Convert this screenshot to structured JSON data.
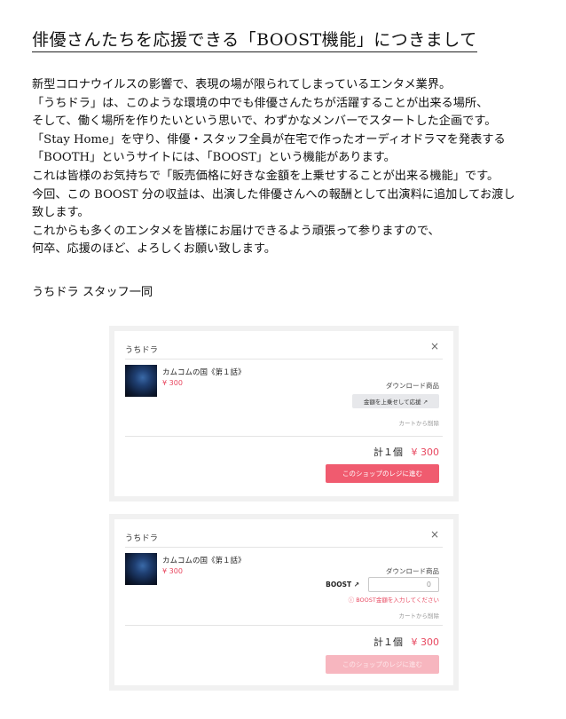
{
  "document": {
    "title": "俳優さんたちを応援できる「BOOST機能」につきまして",
    "paragraph_lines": [
      "新型コロナウイルスの影響で、表現の場が限られてしまっているエンタメ業界。",
      "「うちドラ」は、このような環境の中でも俳優さんたちが活躍することが出来る場所、",
      "そして、働く場所を作りたいという思いで、わずかなメンバーでスタートした企画です。",
      "「Stay Home」を守り、俳優・スタッフ全員が在宅で作ったオーディオドラマを発表する",
      "「BOOTH」というサイトには、「BOOST」という機能があります。",
      "これは皆様のお気持ちで「販売価格に好きな金額を上乗せすることが出来る機能」です。",
      "今回、この BOOST 分の収益は、出演した俳優さんへの報酬として出演料に追加してお渡し",
      "致します。",
      "これからも多くのエンタメを皆様にお届けできるよう頑張って参りますので、",
      "何卒、応援のほど、よろしくお願い致します。"
    ],
    "signature": "うちドラ スタッフ一同"
  },
  "cart_before": {
    "shop_name": "うちドラ",
    "close_glyph": "×",
    "item_title": "カムコムの国《第１話》",
    "item_price": "¥ 300",
    "item_type": "ダウンロード商品",
    "boost_button": "金額を上乗せして応援 ↗",
    "remove_link": "カートから削除",
    "total_count": "計１個",
    "total_price": "¥ 300",
    "checkout_button": "このショップのレジに進む"
  },
  "cart_after": {
    "shop_name": "うちドラ",
    "close_glyph": "×",
    "item_title": "カムコムの国《第１話》",
    "item_price": "¥ 300",
    "item_type": "ダウンロード商品",
    "boost_label": "BOOST ↗",
    "boost_input_value": "0",
    "boost_error": "ⓘ BOOST金額を入力してください",
    "remove_link": "カートから削除",
    "total_count": "計１個",
    "total_price": "¥ 300",
    "checkout_button": "このショップのレジに進む"
  },
  "colors": {
    "accent": "#e8475f",
    "checkout": "#f05b6f",
    "checkout_disabled": "#f7b6bf"
  }
}
